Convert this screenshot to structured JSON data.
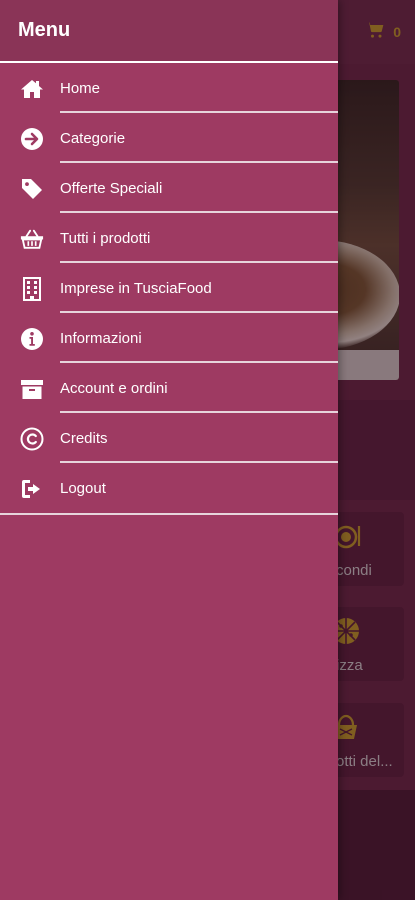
{
  "drawer": {
    "title": "Menu",
    "items": [
      {
        "label": "Home",
        "icon": "home-icon"
      },
      {
        "label": "Categorie",
        "icon": "arrow-circle-right-icon"
      },
      {
        "label": "Offerte Speciali",
        "icon": "tag-icon"
      },
      {
        "label": "Tutti i prodotti",
        "icon": "basket-icon"
      },
      {
        "label": "Imprese in TusciaFood",
        "icon": "building-icon"
      },
      {
        "label": "Informazioni",
        "icon": "info-circle-icon"
      },
      {
        "label": "Account e ordini",
        "icon": "archive-box-icon"
      },
      {
        "label": "Credits",
        "icon": "copyright-icon"
      },
      {
        "label": "Logout",
        "icon": "sign-out-icon"
      }
    ]
  },
  "background": {
    "cart_count": "0",
    "categories": [
      {
        "label": "condi",
        "icon": "plate-cutlery-icon"
      },
      {
        "label": "izza",
        "icon": "pizza-icon"
      },
      {
        "label": "otti del...",
        "icon": "gift-basket-icon"
      }
    ]
  },
  "colors": {
    "drawer_bg": "#9e3a62",
    "drawer_header_bg": "#8a3457",
    "accent_gold": "#c9a227"
  }
}
